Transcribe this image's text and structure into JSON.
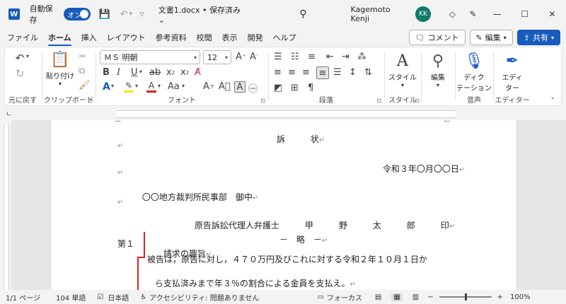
{
  "titlebar": {
    "app_icon": "W",
    "autosave_label": "自動保存",
    "autosave_state": "オン",
    "doc_title": "文書1.docx • 保存済み ⌄",
    "user_name": "Kagemoto Kenji",
    "user_initials": "KK"
  },
  "tabs": [
    "ファイル",
    "ホーム",
    "挿入",
    "レイアウト",
    "参考資料",
    "校閲",
    "表示",
    "開発",
    "ヘルプ"
  ],
  "active_tab": "ホーム",
  "right_buttons": {
    "comment": "コメント",
    "edit": "編集",
    "share": "共有"
  },
  "ribbon": {
    "undo_label": "元に戻す",
    "clipboard": {
      "paste": "貼り付け",
      "label": "クリップボード"
    },
    "font": {
      "name": "ＭＳ 明朝",
      "size": "12",
      "label": "フォント",
      "highlight_color": "#f7e600",
      "font_color": "#e02020"
    },
    "paragraph_label": "段落",
    "style": {
      "button": "スタイル",
      "label": "スタイル"
    },
    "editing": {
      "button": "編集"
    },
    "voice": {
      "button_line1": "ディク",
      "button_line2": "テーション",
      "label": "音声"
    },
    "editor": {
      "button_line1": "エディ",
      "button_line2": "ター",
      "label": "エディター"
    }
  },
  "document": {
    "title": "訴　　　状",
    "date": "令和３年〇月〇〇日",
    "court": "〇〇地方裁判所民事部　御中",
    "attorney": "原告訴訟代理人弁護士　　　甲　　　野　　　太　　　郎　　　印",
    "omission": "－　略　－",
    "section_num": "第１",
    "section_title": "請求の趣旨",
    "body_line1": "被告は，原告に対し，４７０万円及びこれに対する令和２年１０月１日か",
    "body_line2": "ら支払済みまで年３％の割合による金員を支払え。",
    "paragraph_mark": "↵"
  },
  "statusbar": {
    "page": "1/1 ページ",
    "words": "104 単語",
    "language": "日本語",
    "accessibility": "アクセシビリティ: 問題ありません",
    "focus": "フォーカス",
    "zoom": "100%"
  }
}
